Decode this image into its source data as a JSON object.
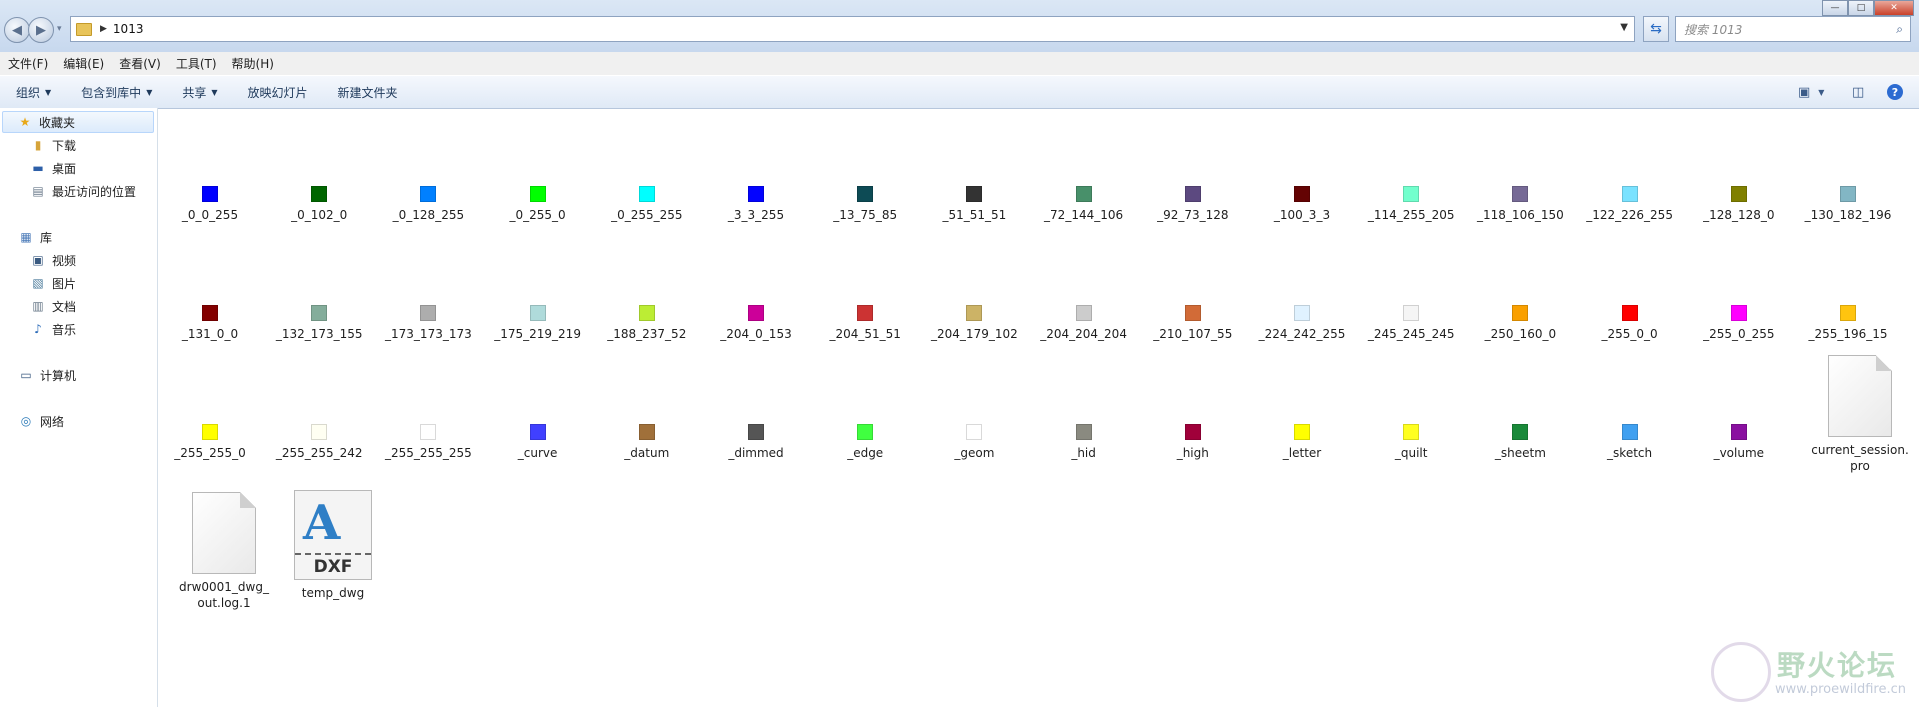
{
  "window": {
    "minimize": "—",
    "maximize": "□",
    "close": "✕"
  },
  "address": {
    "path": "1013",
    "search_placeholder": "搜索 1013"
  },
  "menu": [
    "文件(F)",
    "编辑(E)",
    "查看(V)",
    "工具(T)",
    "帮助(H)"
  ],
  "commands": {
    "organize": "组织",
    "include": "包含到库中",
    "share": "共享",
    "slideshow": "放映幻灯片",
    "newfolder": "新建文件夹"
  },
  "sidebar": {
    "favorites": "收藏夹",
    "downloads": "下载",
    "desktop": "桌面",
    "recent": "最近访问的位置",
    "libraries": "库",
    "videos": "视频",
    "pictures": "图片",
    "documents": "文档",
    "music": "音乐",
    "computer": "计算机",
    "network": "网络"
  },
  "files": [
    {
      "name": "_0_0_255",
      "color": "#0000ff"
    },
    {
      "name": "_0_102_0",
      "color": "#006600"
    },
    {
      "name": "_0_128_255",
      "color": "#0080ff"
    },
    {
      "name": "_0_255_0",
      "color": "#00ff00"
    },
    {
      "name": "_0_255_255",
      "color": "#00ffff"
    },
    {
      "name": "_3_3_255",
      "color": "#0303ff"
    },
    {
      "name": "_13_75_85",
      "color": "#0d4b55"
    },
    {
      "name": "_51_51_51",
      "color": "#333333"
    },
    {
      "name": "_72_144_106",
      "color": "#48906a"
    },
    {
      "name": "_92_73_128",
      "color": "#5c4980"
    },
    {
      "name": "_100_3_3",
      "color": "#640303"
    },
    {
      "name": "_114_255_205",
      "color": "#72ffcd"
    },
    {
      "name": "_118_106_150",
      "color": "#766a96"
    },
    {
      "name": "_122_226_255",
      "color": "#7ae2ff"
    },
    {
      "name": "_128_128_0",
      "color": "#808000"
    },
    {
      "name": "_130_182_196",
      "color": "#82b6c4"
    },
    {
      "name": "_131_0_0",
      "color": "#830000"
    },
    {
      "name": "_132_173_155",
      "color": "#84ad9b"
    },
    {
      "name": "_173_173_173",
      "color": "#adadad"
    },
    {
      "name": "_175_219_219",
      "color": "#afdbdb"
    },
    {
      "name": "_188_237_52",
      "color": "#bced34"
    },
    {
      "name": "_204_0_153",
      "color": "#cc0099"
    },
    {
      "name": "_204_51_51",
      "color": "#cc3333"
    },
    {
      "name": "_204_179_102",
      "color": "#ccb366"
    },
    {
      "name": "_204_204_204",
      "color": "#cccccc"
    },
    {
      "name": "_210_107_55",
      "color": "#d26b37"
    },
    {
      "name": "_224_242_255",
      "color": "#e0f2ff"
    },
    {
      "name": "_245_245_245",
      "color": "#f5f5f5"
    },
    {
      "name": "_250_160_0",
      "color": "#faa000"
    },
    {
      "name": "_255_0_0",
      "color": "#ff0000"
    },
    {
      "name": "_255_0_255",
      "color": "#ff00ff"
    },
    {
      "name": "_255_196_15",
      "color": "#ffc40f"
    },
    {
      "name": "_255_255_0",
      "color": "#ffff00"
    },
    {
      "name": "_255_255_242",
      "color": "#fffff2"
    },
    {
      "name": "_255_255_255",
      "color": "#ffffff"
    },
    {
      "name": "_curve",
      "color": "#4040ff"
    },
    {
      "name": "_datum",
      "color": "#a0703a"
    },
    {
      "name": "_dimmed",
      "color": "#555555"
    },
    {
      "name": "_edge",
      "color": "#40ff40"
    },
    {
      "name": "_geom",
      "color": "#ffffff"
    },
    {
      "name": "_hid",
      "color": "#8a8a80"
    },
    {
      "name": "_high",
      "color": "#a0003a"
    },
    {
      "name": "_letter",
      "color": "#ffff00"
    },
    {
      "name": "_quilt",
      "color": "#ffff20"
    },
    {
      "name": "_sheetm",
      "color": "#1a8a3a"
    },
    {
      "name": "_sketch",
      "color": "#40a0f0"
    },
    {
      "name": "_volume",
      "color": "#8a10a0"
    }
  ],
  "docs": {
    "session_line1": "current_session.",
    "session_line2": "pro",
    "log_line1": "drw0001_dwg_",
    "log_line2": "out.log.1",
    "dxf_name": "temp_dwg",
    "dxf_badge": "DXF"
  },
  "watermark": {
    "title": "野火论坛",
    "url": "www.proewildfire.cn"
  }
}
